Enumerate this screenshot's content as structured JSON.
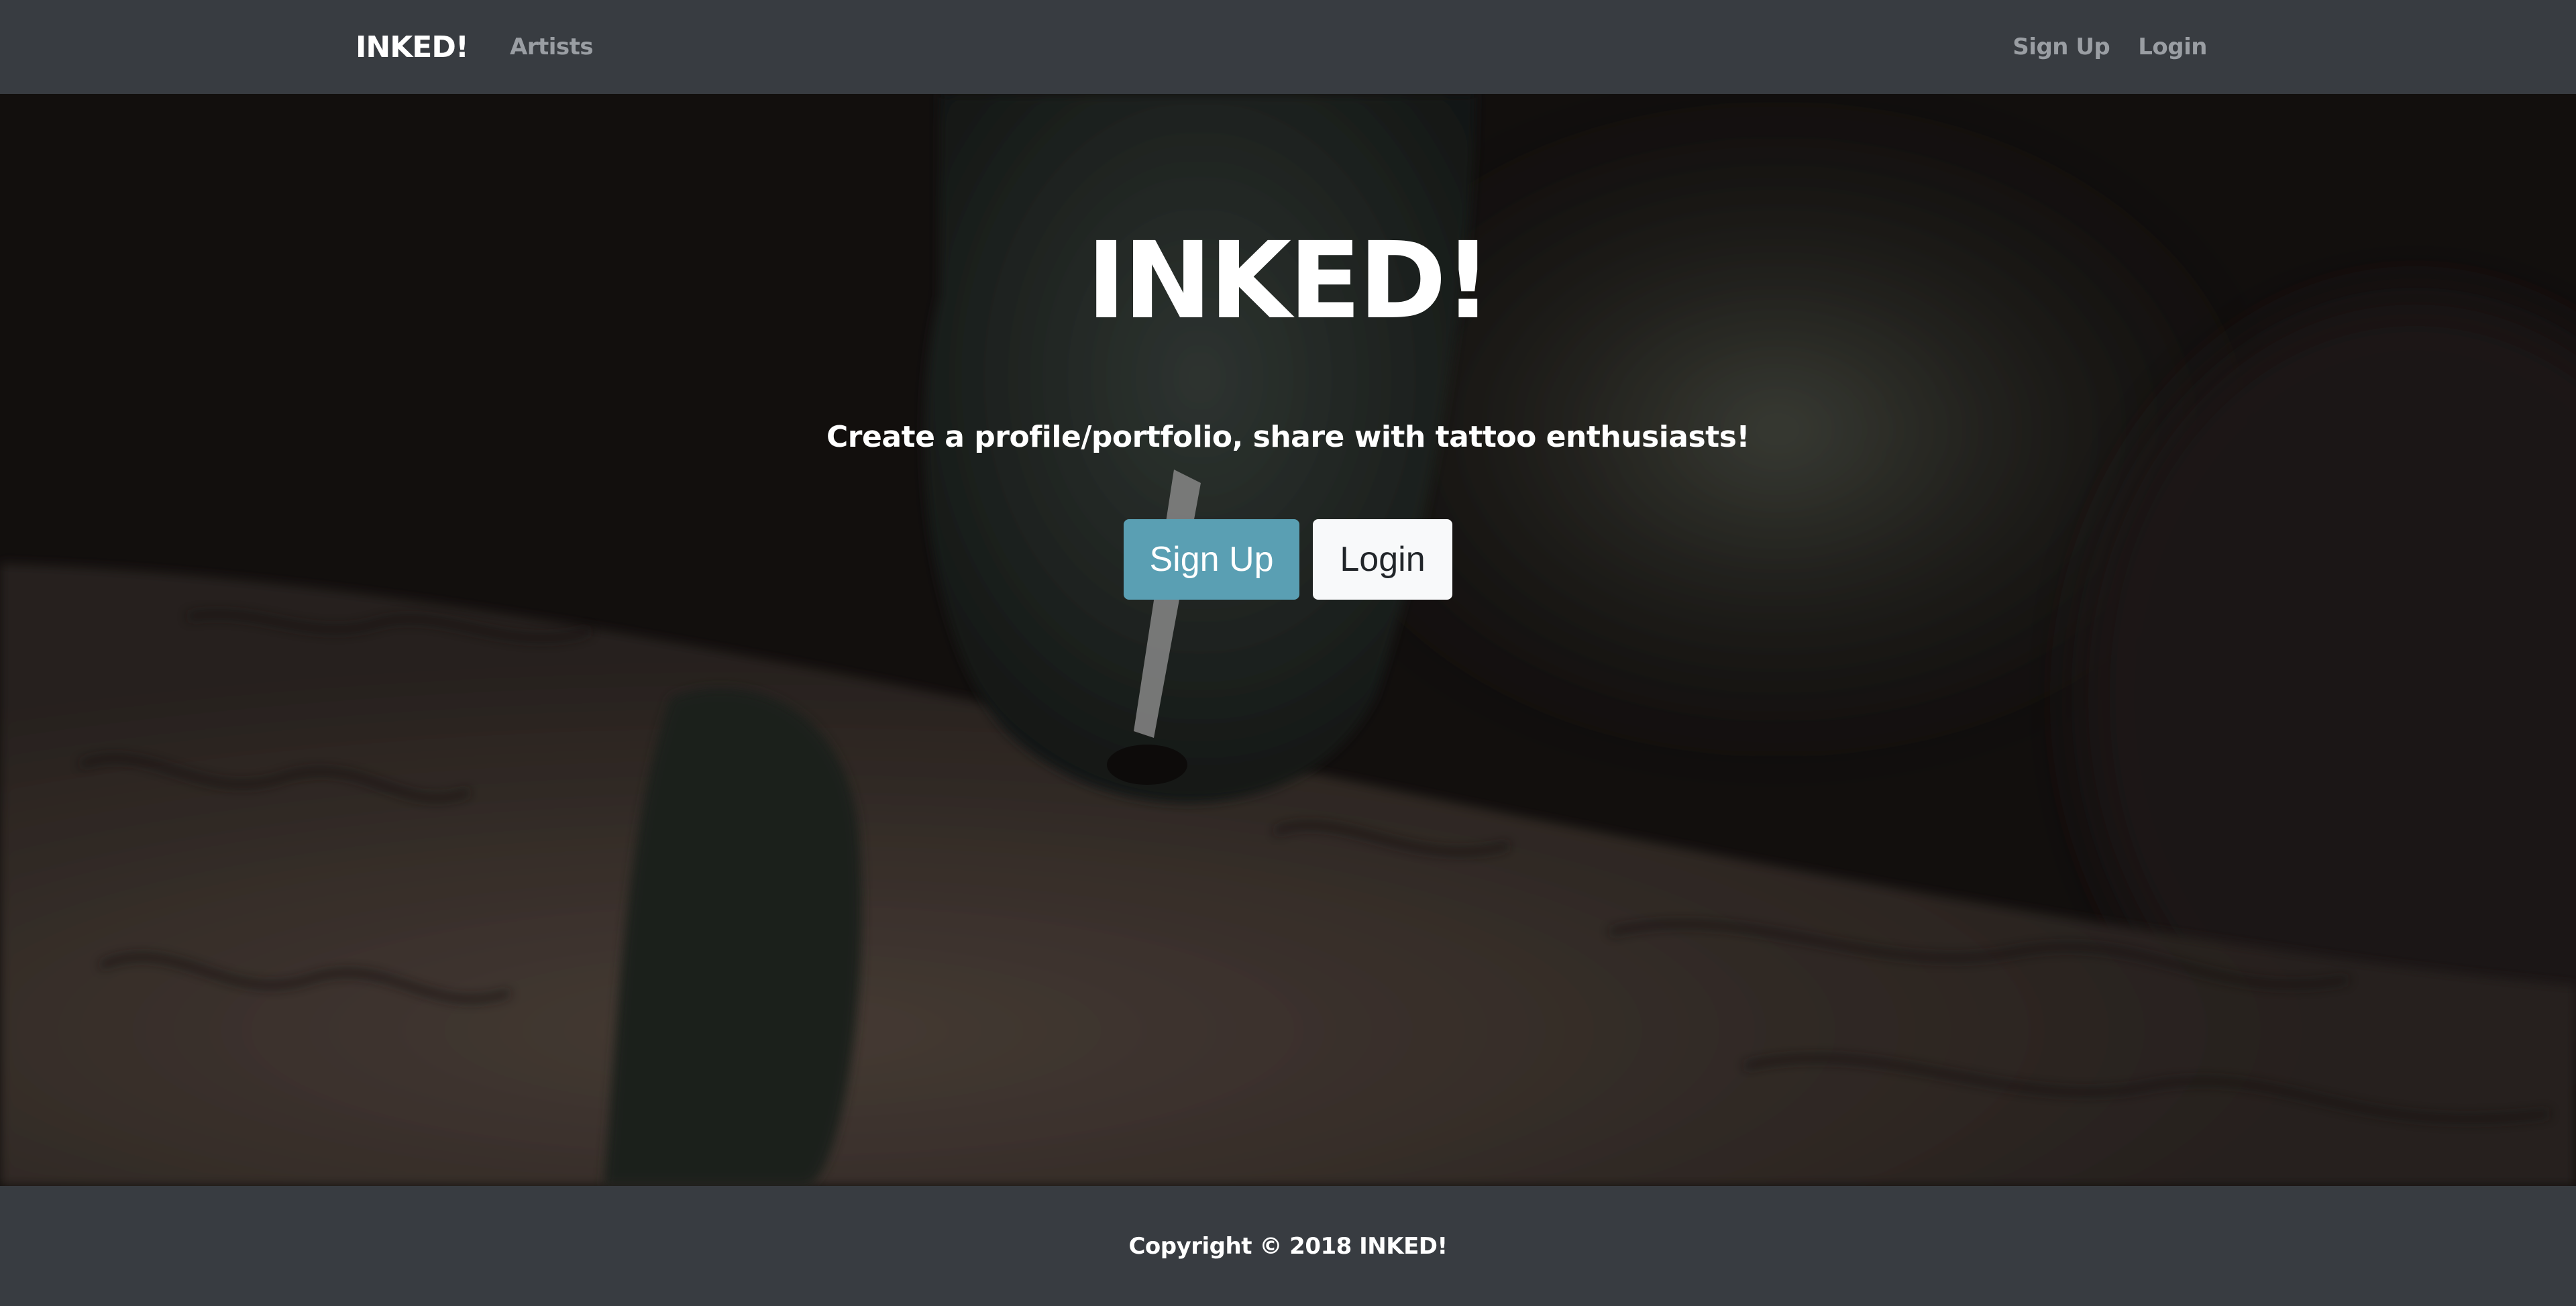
{
  "navbar": {
    "brand": "INKED!",
    "links_left": [
      {
        "label": "Artists"
      }
    ],
    "links_right": [
      {
        "label": "Sign Up"
      },
      {
        "label": "Login"
      }
    ]
  },
  "hero": {
    "title": "INKED!",
    "subtitle": "Create a profile/portfolio, share with tattoo enthusiasts!",
    "signup_label": "Sign Up",
    "login_label": "Login"
  },
  "footer": {
    "copyright": "Copyright © 2018 INKED!"
  },
  "colors": {
    "navbar_bg": "#383c41",
    "signup_button": "#5a9fb3",
    "login_button": "#f8f9fa",
    "nav_link": "#9a9ea3"
  },
  "icons": {
    "hero_background": "tattoo-artist-photo"
  }
}
